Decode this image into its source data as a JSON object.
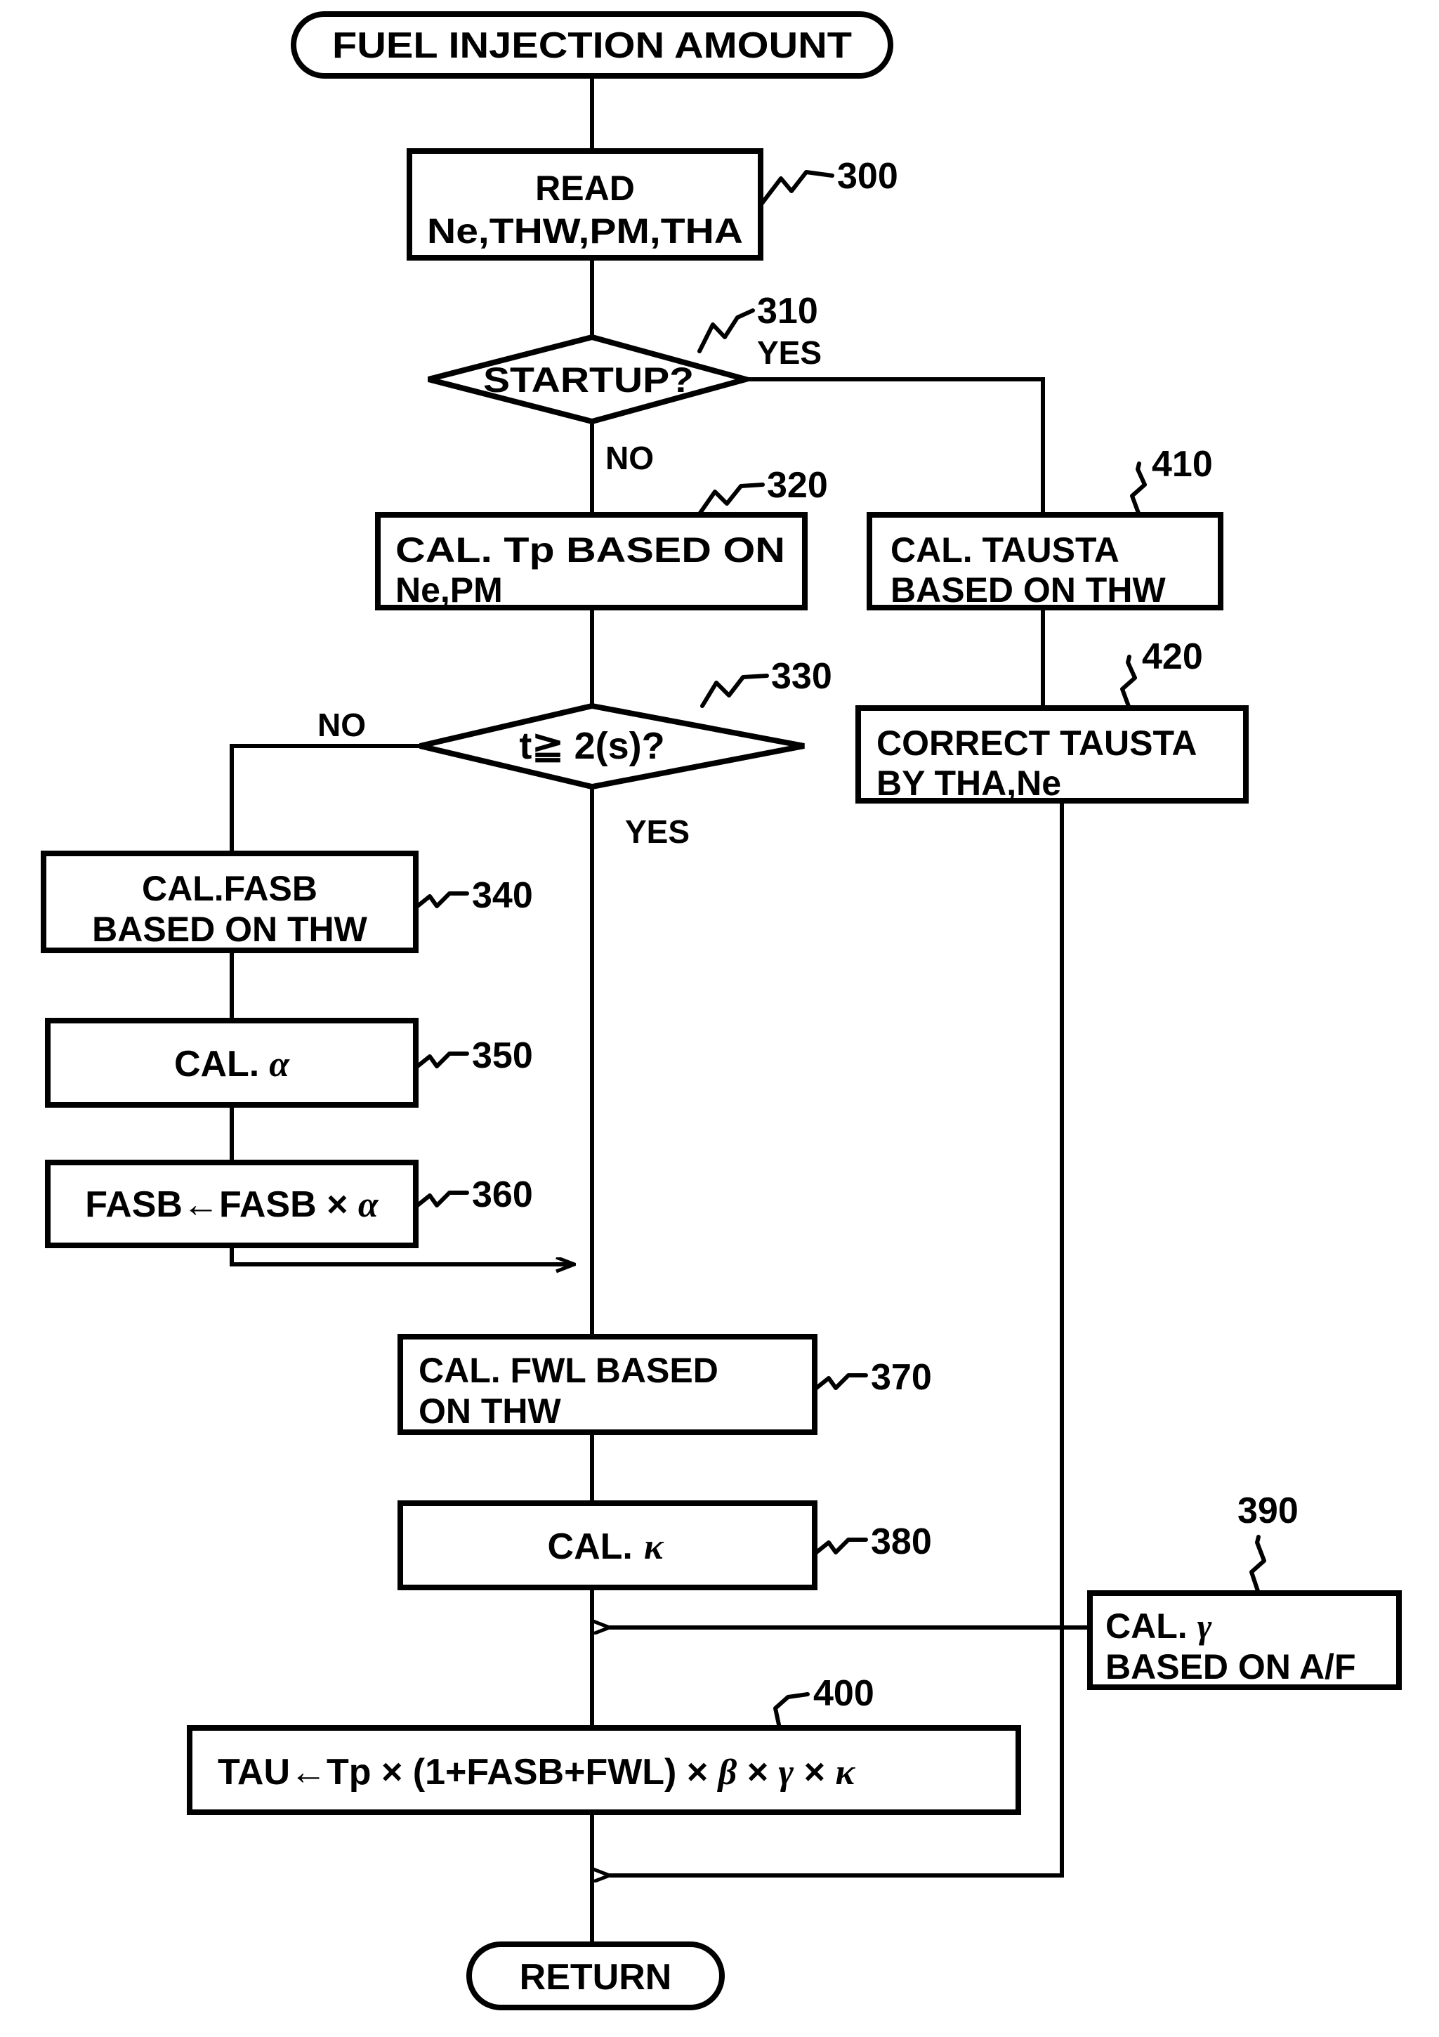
{
  "diagram": {
    "kind": "flowchart",
    "title_node": {
      "label": "FUEL INJECTION AMOUNT",
      "shape": "terminator"
    },
    "end_node": {
      "label": "RETURN",
      "shape": "terminator"
    },
    "nodes": [
      {
        "ref": "300",
        "shape": "process",
        "lines": [
          "READ",
          "Ne,THW,PM,THA"
        ]
      },
      {
        "ref": "310",
        "shape": "decision",
        "lines": [
          "STARTUP?"
        ]
      },
      {
        "ref": "320",
        "shape": "process",
        "lines": [
          "CAL. Tp BASED ON",
          "Ne,PM"
        ]
      },
      {
        "ref": "330",
        "shape": "decision",
        "lines": [
          "t≧ 2(s)?"
        ]
      },
      {
        "ref": "340",
        "shape": "process",
        "lines": [
          "CAL.FASB",
          "BASED ON THW"
        ]
      },
      {
        "ref": "350",
        "shape": "process",
        "lines": [
          "CAL. α"
        ]
      },
      {
        "ref": "360",
        "shape": "process",
        "lines": [
          "FASB←FASB × α"
        ]
      },
      {
        "ref": "370",
        "shape": "process",
        "lines": [
          "CAL. FWL BASED",
          "ON THW"
        ]
      },
      {
        "ref": "380",
        "shape": "process",
        "lines": [
          "CAL. κ"
        ]
      },
      {
        "ref": "390",
        "shape": "process",
        "lines": [
          "CAL. γ",
          "BASED ON A/F"
        ]
      },
      {
        "ref": "400",
        "shape": "process",
        "lines": [
          "TAU←Tp × (1+FASB+FWL) × β × γ × κ"
        ]
      },
      {
        "ref": "410",
        "shape": "process",
        "lines": [
          "CAL. TAUSTA",
          "BASED ON THW"
        ]
      },
      {
        "ref": "420",
        "shape": "process",
        "lines": [
          "CORRECT TAUSTA",
          "BY THA,Ne"
        ]
      }
    ],
    "branch_labels": {
      "startup_yes": "YES",
      "startup_no": "NO",
      "timer_no": "NO",
      "timer_yes": "YES"
    },
    "refs": {
      "r300": "300",
      "r310": "310",
      "r320": "320",
      "r330": "330",
      "r340": "340",
      "r350": "350",
      "r360": "360",
      "r370": "370",
      "r380": "380",
      "r390": "390",
      "r400": "400",
      "r410": "410",
      "r420": "420"
    },
    "text": {
      "start_label": "FUEL INJECTION AMOUNT",
      "n300_l1": "READ",
      "n300_l2": "Ne,THW,PM,THA",
      "n310_l1": "STARTUP?",
      "n320_l1": "CAL. Tp BASED ON",
      "n320_l2": "Ne,PM",
      "n330_l1": "t≧ 2(s)?",
      "n340_l1": "CAL.FASB",
      "n340_l2": "BASED ON THW",
      "n350_l1": "CAL.",
      "n350_g": "α",
      "n360_l1": "FASB←FASB × ",
      "n360_g": "α",
      "n370_l1": "CAL. FWL BASED",
      "n370_l2": "ON THW",
      "n380_l1": "CAL.",
      "n380_g": "κ",
      "n390_l1": "CAL.",
      "n390_g": "γ",
      "n390_l2": "BASED ON A/F",
      "n400_a": "TAU←Tp × (1+FASB+FWL) × ",
      "n400_b": "β",
      "n400_c": " × ",
      "n400_d": "γ",
      "n400_e": " × ",
      "n400_f": "κ",
      "n410_l1": "CAL. TAUSTA",
      "n410_l2": "BASED ON THW",
      "n420_l1": "CORRECT TAUSTA",
      "n420_l2": "BY THA,Ne",
      "end_label": "RETURN",
      "yes1": "YES",
      "no1": "NO",
      "no2": "NO",
      "yes2": "YES"
    },
    "colors": {
      "stroke": "#000000",
      "fill": "#ffffff",
      "background": "#ffffff"
    }
  }
}
